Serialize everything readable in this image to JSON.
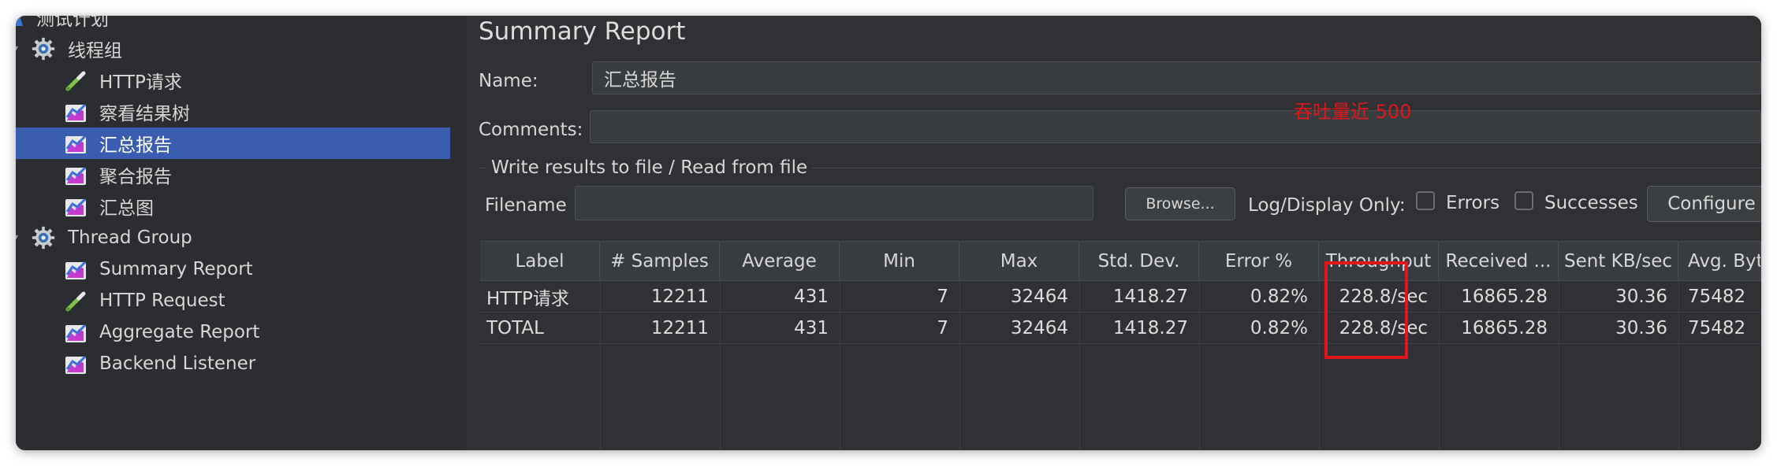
{
  "tree": {
    "items": [
      {
        "label": "测试计划",
        "icon": "test-plan-icon"
      },
      {
        "label": "线程组",
        "icon": "gear-icon"
      },
      {
        "label": "HTTP请求",
        "icon": "pipette-icon"
      },
      {
        "label": "察看结果树",
        "icon": "listener-chart-icon"
      },
      {
        "label": "汇总报告",
        "icon": "listener-chart-icon"
      },
      {
        "label": "聚合报告",
        "icon": "listener-chart-icon"
      },
      {
        "label": "汇总图",
        "icon": "listener-chart-icon"
      },
      {
        "label": "Thread Group",
        "icon": "gear-icon"
      },
      {
        "label": "Summary Report",
        "icon": "listener-chart-icon"
      },
      {
        "label": "HTTP Request",
        "icon": "pipette-icon"
      },
      {
        "label": "Aggregate Report",
        "icon": "listener-chart-icon"
      },
      {
        "label": "Backend Listener",
        "icon": "listener-chart-icon"
      }
    ],
    "selected": "汇总报告"
  },
  "panel": {
    "title": "Summary Report",
    "name_label": "Name:",
    "name_value": "汇总报告",
    "comments_label": "Comments:",
    "comments_value": "",
    "file_group_title": "Write results to file / Read from file",
    "filename_label": "Filename",
    "filename_value": "",
    "browse_label": "Browse...",
    "log_display_label": "Log/Display Only:",
    "errors_label": "Errors",
    "successes_label": "Successes",
    "configure_label": "Configure"
  },
  "annotation": {
    "text": "吞吐量近 500",
    "color": "#e0161b"
  },
  "table": {
    "headers": [
      "Label",
      "# Samples",
      "Average",
      "Min",
      "Max",
      "Std. Dev.",
      "Error %",
      "Throughput",
      "Received ...",
      "Sent KB/sec",
      "Avg. Bytes"
    ],
    "rows": [
      [
        "HTTP请求",
        "12211",
        "431",
        "7",
        "32464",
        "1418.27",
        "0.82%",
        "228.8/sec",
        "16865.28",
        "30.36",
        "75482"
      ],
      [
        "TOTAL",
        "12211",
        "431",
        "7",
        "32464",
        "1418.27",
        "0.82%",
        "228.8/sec",
        "16865.28",
        "30.36",
        "75482"
      ]
    ]
  },
  "colors": {
    "background": "#2b2d30",
    "selection": "#3a5db0",
    "highlight_box": "#e3141a"
  }
}
